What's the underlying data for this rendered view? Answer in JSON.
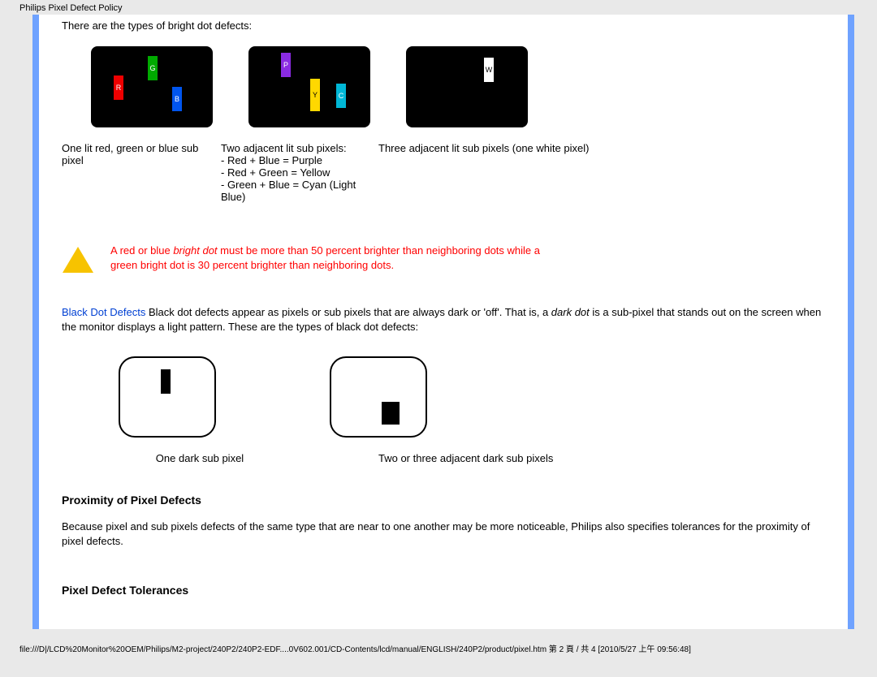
{
  "header": {
    "title": "Philips Pixel Defect Policy"
  },
  "intro": "There are the types of bright dot defects:",
  "bright": {
    "fig1": {
      "r": "R",
      "g": "G",
      "b": "B"
    },
    "fig2": {
      "p": "P",
      "y": "Y",
      "c": "C"
    },
    "fig3": {
      "w": "W"
    },
    "cap1": "One lit red, green or blue sub pixel",
    "cap2": "Two adjacent lit sub pixels:\n- Red + Blue = Purple\n- Red + Green = Yellow\n- Green + Blue = Cyan (Light Blue)",
    "cap3": "Three adjacent lit sub pixels (one white pixel)"
  },
  "warning": {
    "pre": "A red or blue ",
    "em": "bright dot",
    "post": " must be more than 50 percent brighter than neighboring dots while a green bright dot is 30 percent brighter than neighboring dots."
  },
  "blackdot": {
    "head": "Black Dot Defects",
    "body_pre": " Black dot defects appear as pixels or sub pixels that are always dark or 'off'. That is, a ",
    "em": "dark dot",
    "body_post": " is a sub-pixel that stands out on the screen when the monitor displays a light pattern. These are the types of black dot defects:"
  },
  "dark": {
    "cap1": "One dark sub pixel",
    "cap2": "Two or three adjacent dark sub pixels"
  },
  "proximity": {
    "heading": "Proximity of Pixel Defects",
    "body": "Because pixel and sub pixels defects of the same type that are near to one another may be more noticeable, Philips also specifies tolerances for the proximity of pixel defects."
  },
  "tolerances": {
    "heading": "Pixel Defect Tolerances"
  },
  "footer": "file:///D|/LCD%20Monitor%20OEM/Philips/M2-project/240P2/240P2-EDF....0V602.001/CD-Contents/lcd/manual/ENGLISH/240P2/product/pixel.htm 第 2 頁 / 共 4  [2010/5/27 上午 09:56:48]"
}
